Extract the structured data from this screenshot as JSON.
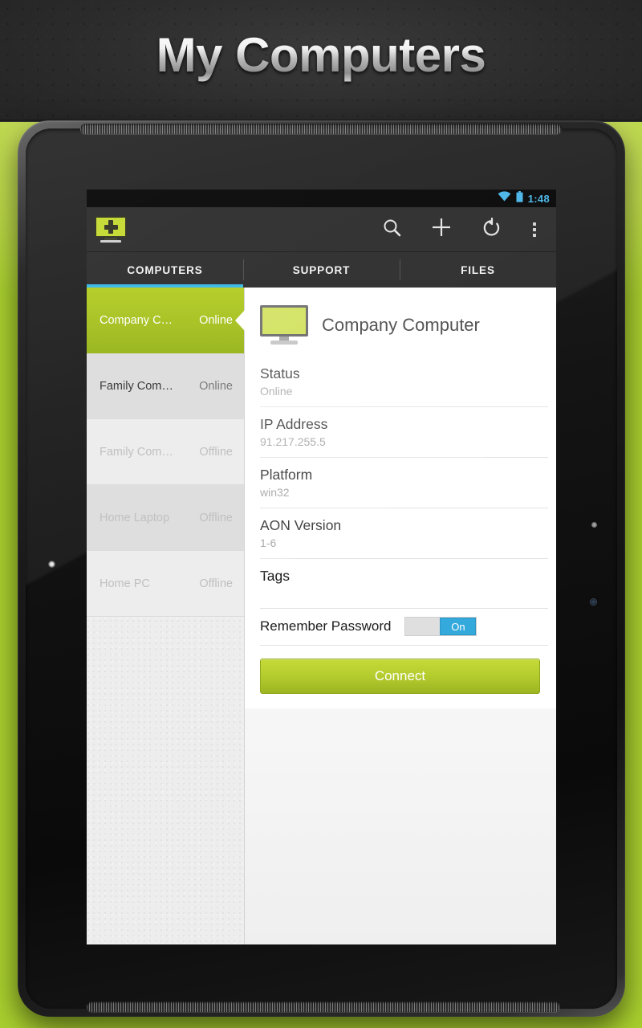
{
  "banner": {
    "title": "My Computers"
  },
  "status_bar": {
    "time": "1:48",
    "wifi_icon": "wifi-icon",
    "battery_icon": "battery-icon",
    "accent": "#45b4e8"
  },
  "action_bar": {
    "logo_icon": "app-logo-monitor-plus-icon",
    "actions": [
      {
        "name": "search-button",
        "icon": "search-icon"
      },
      {
        "name": "add-button",
        "icon": "plus-icon"
      },
      {
        "name": "refresh-button",
        "icon": "refresh-icon"
      },
      {
        "name": "overflow-button",
        "icon": "overflow-menu-icon"
      }
    ]
  },
  "tabs": {
    "items": [
      {
        "label": "COMPUTERS",
        "selected": true
      },
      {
        "label": "SUPPORT",
        "selected": false
      },
      {
        "label": "FILES",
        "selected": false
      }
    ],
    "indicator_color": "#33b5e5"
  },
  "sidebar": {
    "items": [
      {
        "name": "Company C…",
        "status": "Online",
        "state": "selected"
      },
      {
        "name": "Family Com…",
        "status": "Online",
        "state": "online"
      },
      {
        "name": "Family Com…",
        "status": "Offline",
        "state": "offline"
      },
      {
        "name": "Home Laptop",
        "status": "Offline",
        "state": "offline"
      },
      {
        "name": "Home PC",
        "status": "Offline",
        "state": "offline"
      }
    ],
    "selected_color": "#aac42a"
  },
  "detail": {
    "icon": "monitor-icon",
    "title": "Company Computer",
    "fields": [
      {
        "label": "Status",
        "value": "Online"
      },
      {
        "label": "IP Address",
        "value": "91.217.255.5"
      },
      {
        "label": "Platform",
        "value": "win32"
      },
      {
        "label": "AON Version",
        "value": "1-6"
      },
      {
        "label": "Tags",
        "value": ""
      }
    ],
    "remember_password": {
      "label": "Remember Password",
      "state": "On",
      "on_color": "#33a9dc"
    },
    "connect_label": "Connect",
    "connect_color": "#b5cc2e"
  },
  "nav_bar": {
    "buttons": [
      {
        "name": "back-button",
        "icon": "back-icon"
      },
      {
        "name": "home-button",
        "icon": "home-icon"
      },
      {
        "name": "recents-button",
        "icon": "recents-icon"
      }
    ]
  }
}
